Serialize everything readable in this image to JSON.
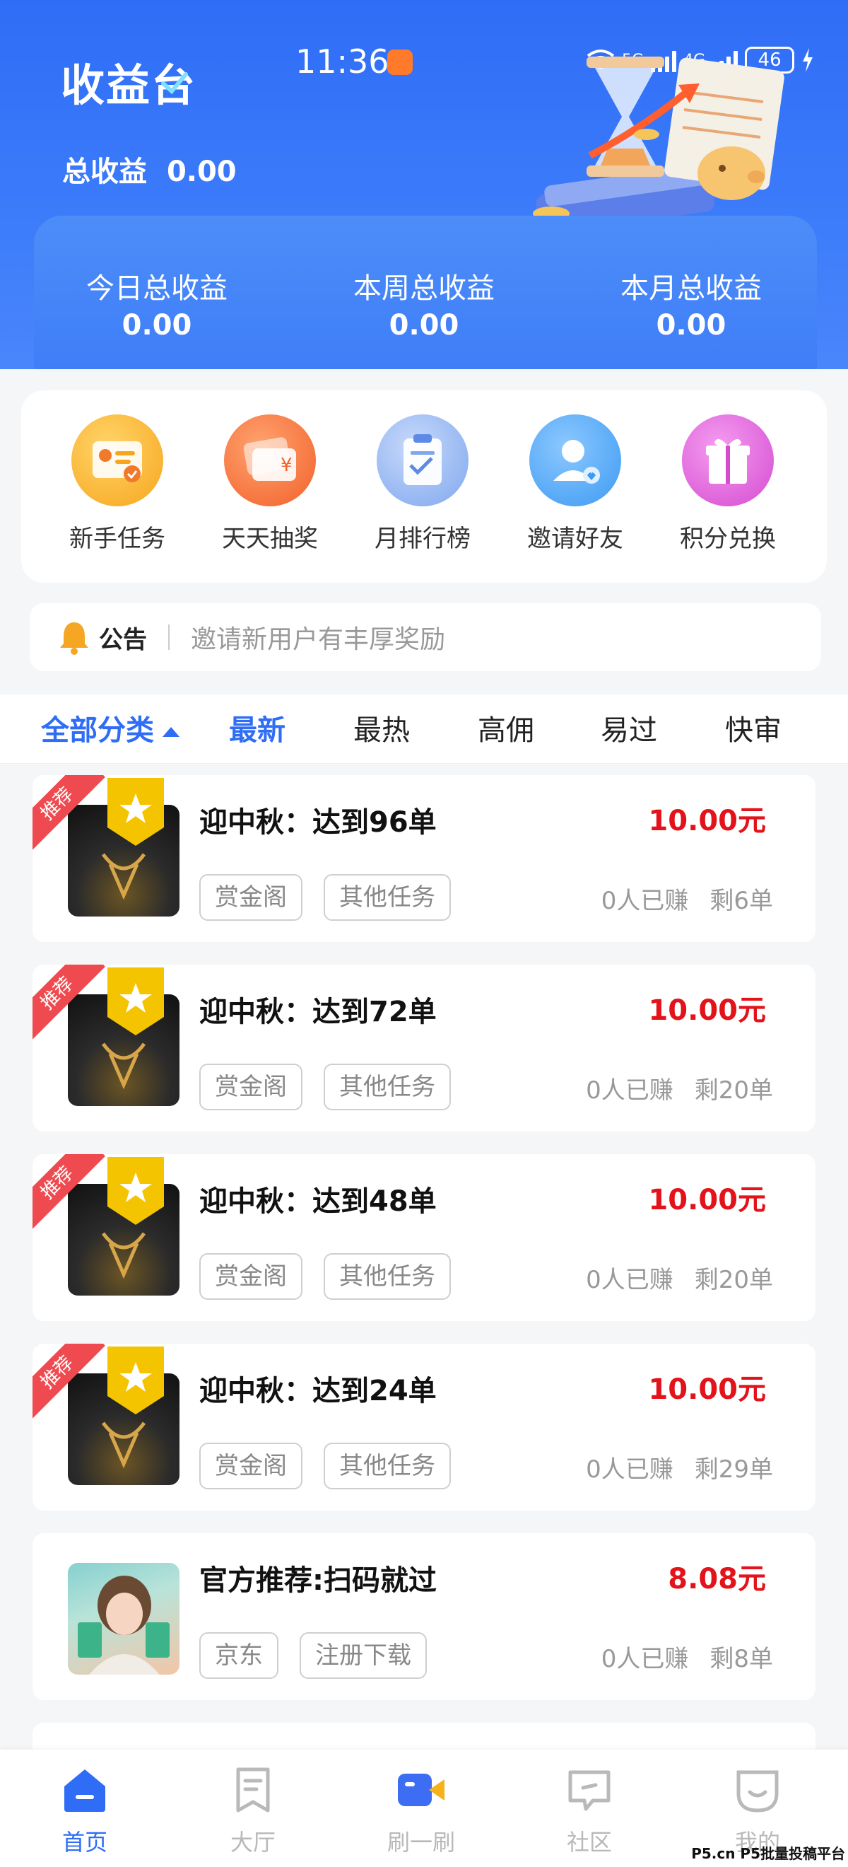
{
  "status_bar": {
    "time": "11:36",
    "network": "5G",
    "network2": "4G",
    "battery": "46"
  },
  "header": {
    "title": "收益台",
    "total_label": "总收益",
    "total_value": "0.00",
    "summary": [
      {
        "label": "今日总收益",
        "value": "0.00"
      },
      {
        "label": "本周总收益",
        "value": "0.00"
      },
      {
        "label": "本月总收益",
        "value": "0.00"
      }
    ]
  },
  "quick_actions": [
    {
      "label": "新手任务",
      "icon": "task-card-icon",
      "color": "#f7a51c"
    },
    {
      "label": "天天抽奖",
      "icon": "lottery-card-icon",
      "color": "#f46a2d"
    },
    {
      "label": "月排行榜",
      "icon": "ranking-clipboard-icon",
      "color": "#79a4ee"
    },
    {
      "label": "邀请好友",
      "icon": "invite-user-icon",
      "color": "#3d9af2"
    },
    {
      "label": "积分兑换",
      "icon": "gift-icon",
      "color": "#dc55d4"
    }
  ],
  "notice": {
    "title": "公告",
    "message": "邀请新用户有丰厚奖励"
  },
  "tabs": [
    {
      "label": "全部分类"
    },
    {
      "label": "最新"
    },
    {
      "label": "最热"
    },
    {
      "label": "高佣"
    },
    {
      "label": "易过"
    },
    {
      "label": "快审"
    }
  ],
  "tasks": [
    {
      "ribbon": "推荐",
      "title": "迎中秋：达到96单",
      "price": "10.00元",
      "tags": [
        "赏金阁",
        "其他任务"
      ],
      "earned": "0人已赚",
      "remaining": "剩6单"
    },
    {
      "ribbon": "推荐",
      "title": "迎中秋：达到72单",
      "price": "10.00元",
      "tags": [
        "赏金阁",
        "其他任务"
      ],
      "earned": "0人已赚",
      "remaining": "剩20单"
    },
    {
      "ribbon": "推荐",
      "title": "迎中秋：达到48单",
      "price": "10.00元",
      "tags": [
        "赏金阁",
        "其他任务"
      ],
      "earned": "0人已赚",
      "remaining": "剩20单"
    },
    {
      "ribbon": "推荐",
      "title": "迎中秋：达到24单",
      "price": "10.00元",
      "tags": [
        "赏金阁",
        "其他任务"
      ],
      "earned": "0人已赚",
      "remaining": "剩29单"
    },
    {
      "title": "官方推荐:扫码就过",
      "price": "8.08元",
      "tags": [
        "京东",
        "注册下载"
      ],
      "earned": "0人已赚",
      "remaining": "剩8单"
    }
  ],
  "bottom_nav": [
    {
      "label": "首页",
      "icon": "home-icon"
    },
    {
      "label": "大厅",
      "icon": "bookmark-hall-icon"
    },
    {
      "label": "刷一刷",
      "icon": "video-camera-icon"
    },
    {
      "label": "社区",
      "icon": "chat-bubble-icon"
    },
    {
      "label": "我的",
      "icon": "smile-face-icon"
    }
  ],
  "watermark": "P5.cn P5批量投稿平台",
  "colors": {
    "primary": "#2f6df6",
    "price": "#e3131b",
    "ribbon": "#ef4a4f"
  }
}
